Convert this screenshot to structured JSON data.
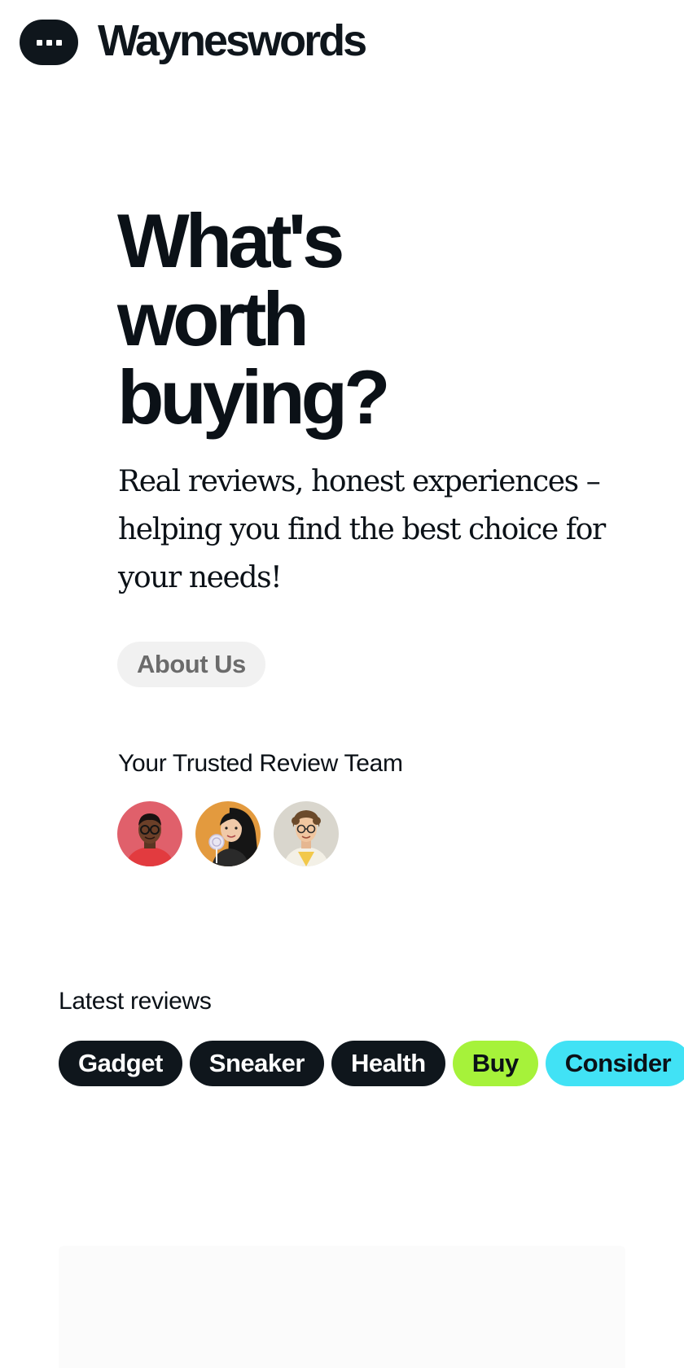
{
  "header": {
    "menu_icon": "more-horizontal-icon",
    "brand": "Wayneswords"
  },
  "hero": {
    "title_lines": [
      "What's",
      "worth",
      "buying?"
    ],
    "subtitle": "Real reviews, honest experiences – helping you find the best choice for your needs!",
    "about_button": "About Us"
  },
  "team": {
    "heading": "Your Trusted Review Team",
    "members": [
      {
        "avatar": "reviewer-1-avatar",
        "background": "#e0606b"
      },
      {
        "avatar": "reviewer-2-avatar",
        "background": "#e39a3e"
      },
      {
        "avatar": "reviewer-3-avatar",
        "background": "#d9d6cd"
      }
    ]
  },
  "latest": {
    "heading": "Latest reviews",
    "tags": [
      {
        "label": "Gadget",
        "style": "dark",
        "color": "#0f161c"
      },
      {
        "label": "Sneaker",
        "style": "dark",
        "color": "#0f161c"
      },
      {
        "label": "Health",
        "style": "dark",
        "color": "#0f161c"
      },
      {
        "label": "Buy",
        "style": "lime",
        "color": "#a6f23a"
      },
      {
        "label": "Consider",
        "style": "cyan",
        "color": "#41e2f5"
      }
    ]
  }
}
